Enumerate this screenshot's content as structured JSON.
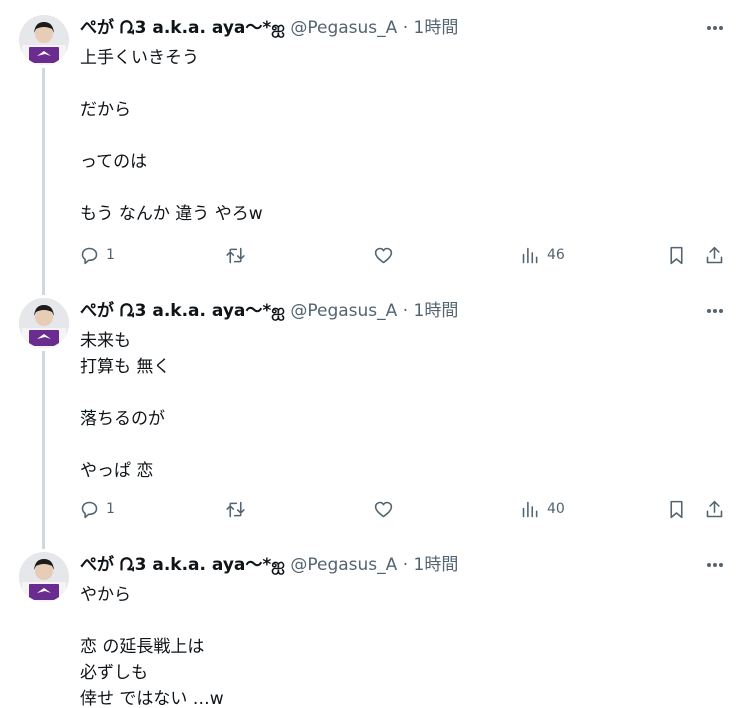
{
  "author": {
    "display_name": "ぺが ᘩ3 a.k.a. aya〜*ஐ",
    "handle": "@Pegasus_A",
    "separator": "·",
    "time": "1時間"
  },
  "icons": {
    "more": "more-horizontal-icon",
    "reply": "reply-bubble-icon",
    "retweet": "retweet-icon",
    "like": "heart-icon",
    "views": "analytics-bars-icon",
    "bookmark": "bookmark-icon",
    "share": "share-upload-icon"
  },
  "colors": {
    "text": "#0f1419",
    "secondary": "#536471",
    "thread_line": "#cfd9de",
    "avatar_shirt": "#6b2c8f"
  },
  "tweets": [
    {
      "lines": [
        "上手くいきそう",
        "",
        "だから",
        "",
        "ってのは",
        "",
        "もう なんか 違う やろw"
      ],
      "replies": "1",
      "views": "46"
    },
    {
      "lines": [
        "未来も",
        "打算も 無く",
        "",
        "落ちるのが",
        "",
        "やっぱ 恋"
      ],
      "replies": "1",
      "views": "40"
    },
    {
      "lines": [
        "やから",
        "",
        "恋 の延長戦上は",
        "必ずしも",
        "倖せ ではない …w"
      ]
    }
  ]
}
